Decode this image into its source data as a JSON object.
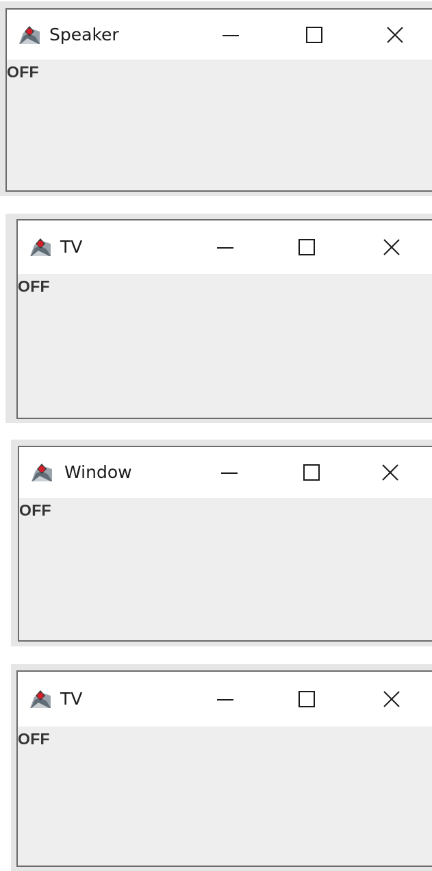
{
  "windows": [
    {
      "title": "Speaker",
      "status": "OFF",
      "icon": "java-duke-icon",
      "controls": [
        "minimize-icon",
        "maximize-icon",
        "close-icon"
      ]
    },
    {
      "title": "TV",
      "status": "OFF",
      "icon": "java-duke-icon",
      "controls": [
        "minimize-icon",
        "maximize-icon",
        "close-icon"
      ]
    },
    {
      "title": "Window",
      "status": "OFF",
      "icon": "java-duke-icon",
      "controls": [
        "minimize-icon",
        "maximize-icon",
        "close-icon"
      ]
    },
    {
      "title": "TV",
      "status": "OFF",
      "icon": "java-duke-icon",
      "controls": [
        "minimize-icon",
        "maximize-icon",
        "close-icon"
      ]
    }
  ],
  "colors": {
    "titlebar_bg": "#ffffff",
    "content_bg": "#eeeeee",
    "frame_border": "#6b6b6b",
    "status_text": "#333333",
    "icon_accent": "#d21f2a"
  }
}
